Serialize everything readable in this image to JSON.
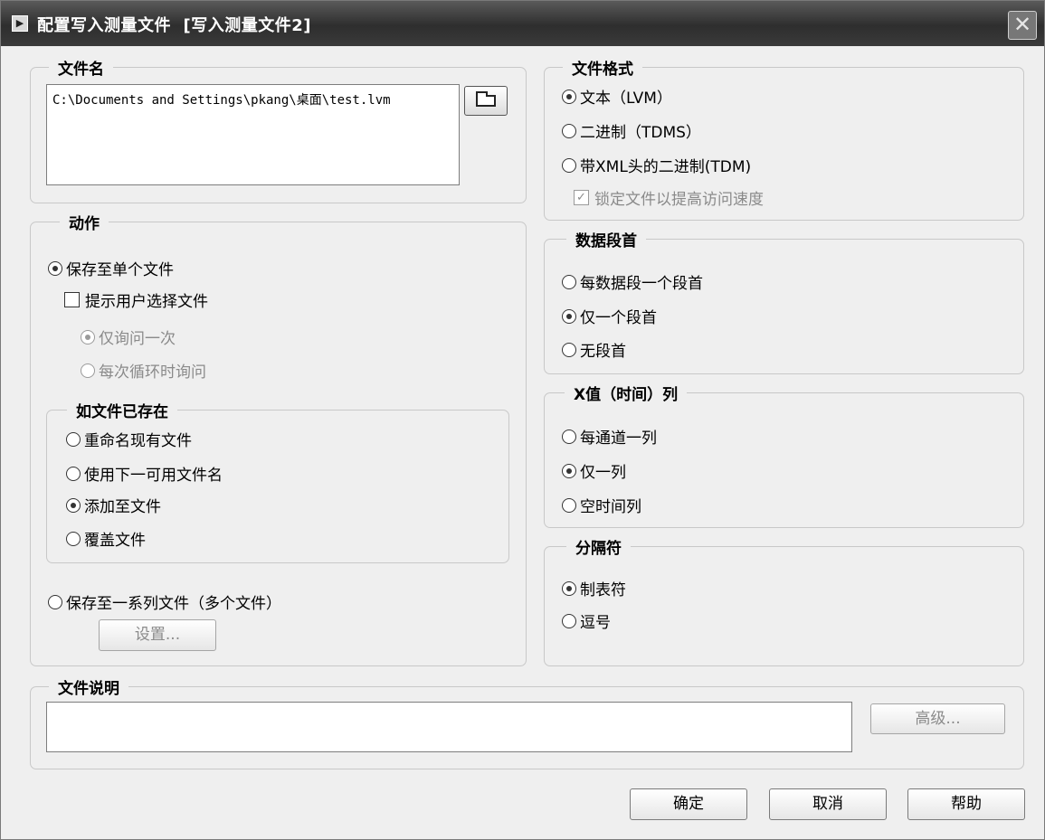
{
  "window": {
    "title": "配置写入测量文件  [写入测量文件2]",
    "close_glyph": "✕",
    "icon": "labview-express-icon"
  },
  "filename": {
    "legend": "文件名",
    "value": "C:\\Documents and Settings\\pkang\\桌面\\test.lvm"
  },
  "action": {
    "legend": "动作",
    "save_single": "保存至单个文件",
    "prompt_user": "提示用户选择文件",
    "ask_once": "仅询问一次",
    "ask_each_loop": "每次循环时询问",
    "if_exists": {
      "legend": "如文件已存在",
      "rename": "重命名现有文件",
      "next_available": "使用下一可用文件名",
      "append": "添加至文件",
      "overwrite": "覆盖文件"
    },
    "save_series": "保存至一系列文件（多个文件）",
    "settings_button": "设置..."
  },
  "file_format": {
    "legend": "文件格式",
    "text_lvm": "文本（LVM）",
    "binary_tdms": "二进制（TDMS）",
    "binary_xml": "带XML头的二进制(TDM)",
    "lock_file": "锁定文件以提高访问速度"
  },
  "segment_header": {
    "legend": "数据段首",
    "per_segment": "每数据段一个段首",
    "only_one": "仅一个段首",
    "none": "无段首"
  },
  "x_column": {
    "legend": "X值（时间）列",
    "per_channel": "每通道一列",
    "only_one": "仅一列",
    "empty": "空时间列"
  },
  "delimiter": {
    "legend": "分隔符",
    "tab": "制表符",
    "comma": "逗号"
  },
  "description": {
    "legend": "文件说明",
    "value": "",
    "advanced_button": "高级..."
  },
  "footer": {
    "ok": "确定",
    "cancel": "取消",
    "help": "帮助"
  }
}
